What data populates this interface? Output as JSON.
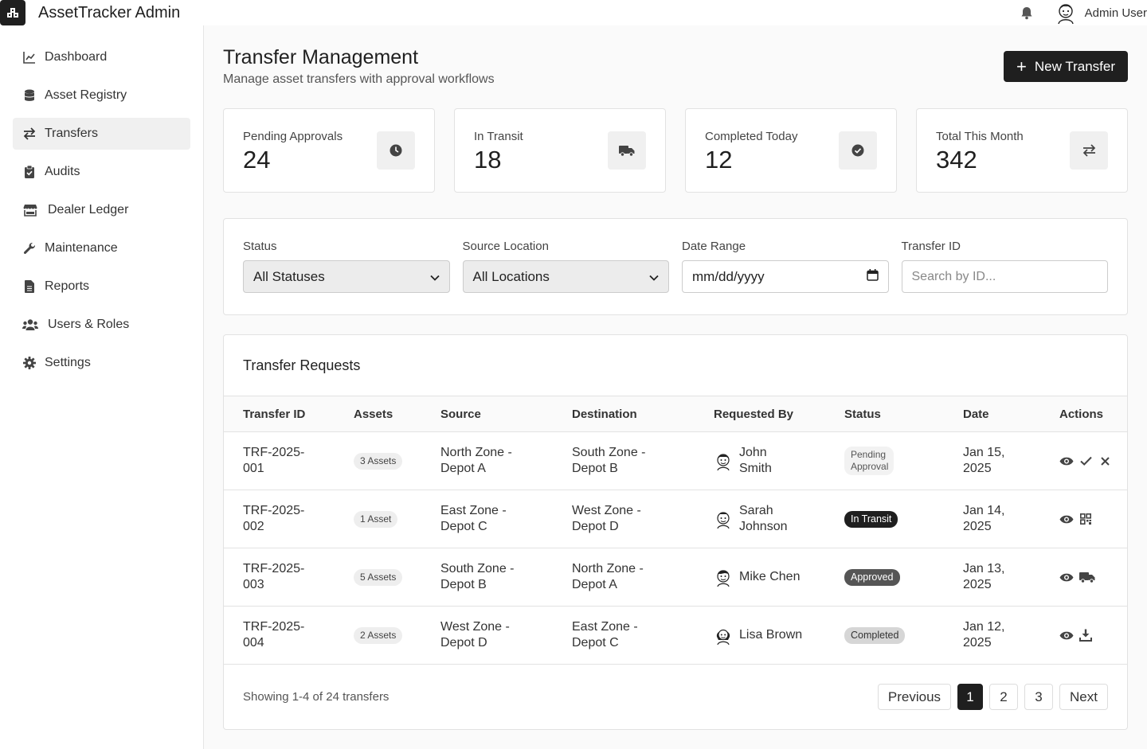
{
  "header": {
    "app_title": "AssetTracker Admin",
    "user_name": "Admin User",
    "icons": {
      "logo": "boxes-icon",
      "bell": "bell-icon",
      "avatar": "user-avatar"
    }
  },
  "sidebar": {
    "items": [
      {
        "label": "Dashboard",
        "icon": "chart-line-icon",
        "active": false
      },
      {
        "label": "Asset Registry",
        "icon": "database-icon",
        "active": false
      },
      {
        "label": "Transfers",
        "icon": "arrows-exchange-icon",
        "active": true
      },
      {
        "label": "Audits",
        "icon": "clipboard-check-icon",
        "active": false
      },
      {
        "label": "Dealer Ledger",
        "icon": "store-icon",
        "active": false
      },
      {
        "label": "Maintenance",
        "icon": "wrench-icon",
        "active": false
      },
      {
        "label": "Reports",
        "icon": "file-icon",
        "active": false
      },
      {
        "label": "Users & Roles",
        "icon": "users-icon",
        "active": false
      },
      {
        "label": "Settings",
        "icon": "gear-icon",
        "active": false
      }
    ]
  },
  "page": {
    "title": "Transfer Management",
    "subtitle": "Manage asset transfers with approval workflows",
    "new_button": "New Transfer"
  },
  "stats": [
    {
      "label": "Pending Approvals",
      "value": "24",
      "icon": "clock-icon"
    },
    {
      "label": "In Transit",
      "value": "18",
      "icon": "truck-icon"
    },
    {
      "label": "Completed Today",
      "value": "12",
      "icon": "check-circle-icon"
    },
    {
      "label": "Total This Month",
      "value": "342",
      "icon": "exchange-icon"
    }
  ],
  "filters": {
    "status": {
      "label": "Status",
      "value": "All Statuses"
    },
    "source": {
      "label": "Source Location",
      "value": "All Locations"
    },
    "date": {
      "label": "Date Range",
      "value": "mm/dd/yyyy"
    },
    "transfer_id": {
      "label": "Transfer ID",
      "placeholder": "Search by ID..."
    }
  },
  "table": {
    "title": "Transfer Requests",
    "columns": [
      "Transfer ID",
      "Assets",
      "Source",
      "Destination",
      "Requested By",
      "Status",
      "Date",
      "Actions"
    ],
    "rows": [
      {
        "id": "TRF-2025-001",
        "assets": "3 Assets",
        "source": "North Zone - Depot A",
        "destination": "South Zone - Depot B",
        "requested_by": "John Smith",
        "status": "Pending Approval",
        "date": "Jan 15, 2025",
        "actions": [
          "eye-icon",
          "check-icon",
          "close-icon"
        ]
      },
      {
        "id": "TRF-2025-002",
        "assets": "1 Asset",
        "source": "East Zone - Depot C",
        "destination": "West Zone - Depot D",
        "requested_by": "Sarah Johnson",
        "status": "In Transit",
        "date": "Jan 14, 2025",
        "actions": [
          "eye-icon",
          "qrcode-icon"
        ]
      },
      {
        "id": "TRF-2025-003",
        "assets": "5 Assets",
        "source": "South Zone - Depot B",
        "destination": "North Zone - Depot A",
        "requested_by": "Mike Chen",
        "status": "Approved",
        "date": "Jan 13, 2025",
        "actions": [
          "eye-icon",
          "truck-icon"
        ]
      },
      {
        "id": "TRF-2025-004",
        "assets": "2 Assets",
        "source": "West Zone - Depot D",
        "destination": "East Zone - Depot C",
        "requested_by": "Lisa Brown",
        "status": "Completed",
        "date": "Jan 12, 2025",
        "actions": [
          "eye-icon",
          "download-icon"
        ]
      }
    ],
    "footer": {
      "showing": "Showing 1-4 of 24 transfers",
      "previous": "Previous",
      "pages": [
        "1",
        "2",
        "3"
      ],
      "current_page": "1",
      "next": "Next"
    }
  }
}
